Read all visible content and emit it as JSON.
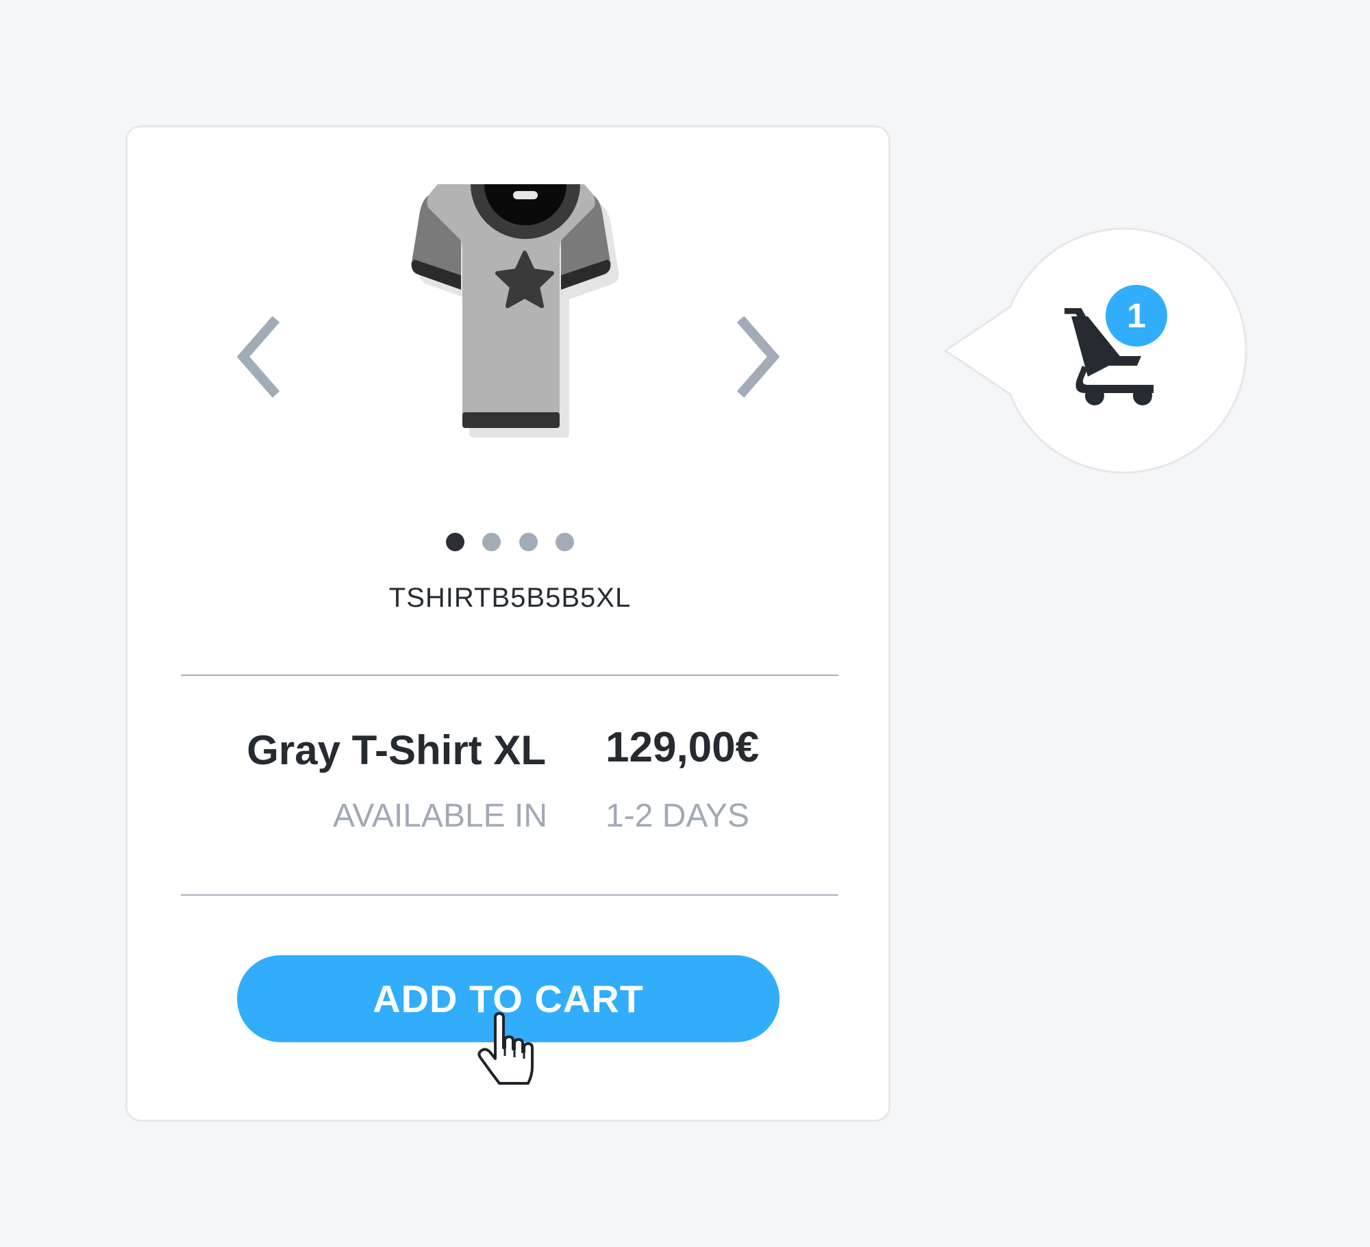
{
  "product": {
    "sku": "TSHIRTB5B5B5XL",
    "name": "Gray T-Shirt XL",
    "price": "129,00€",
    "availability_label": "AVAILABLE IN",
    "availability_value": "1-2 DAYS",
    "image_icon": "t-shirt-with-star"
  },
  "carousel": {
    "slide_count": 4,
    "active_index": 0,
    "prev_icon": "chevron-left-icon",
    "next_icon": "chevron-right-icon"
  },
  "actions": {
    "add_to_cart_label": "ADD TO CART"
  },
  "cart": {
    "icon": "shopping-cart-icon",
    "count": "1"
  },
  "colors": {
    "accent": "#31adfb",
    "text_dark": "#262b31",
    "text_muted": "#a0a9b5",
    "arrow": "#a2acb8",
    "background": "#f5f6f8"
  }
}
